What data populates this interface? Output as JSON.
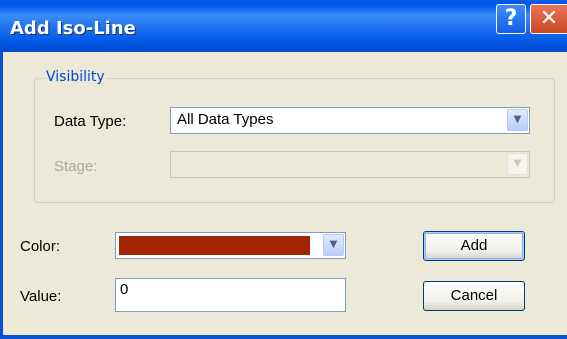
{
  "window": {
    "title": "Add Iso-Line",
    "help_glyph": "?",
    "close_glyph": "✕"
  },
  "visibility": {
    "legend": "Visibility",
    "data_type": {
      "label": "Data Type:",
      "value": "All Data Types"
    },
    "stage": {
      "label": "Stage:",
      "value": ""
    }
  },
  "color": {
    "label": "Color:",
    "swatch_hex": "#a32400"
  },
  "value": {
    "label": "Value:",
    "value": "0"
  },
  "buttons": {
    "add": "Add",
    "cancel": "Cancel"
  },
  "icons": {
    "dropdown_arrow": "chevron-down-icon"
  }
}
